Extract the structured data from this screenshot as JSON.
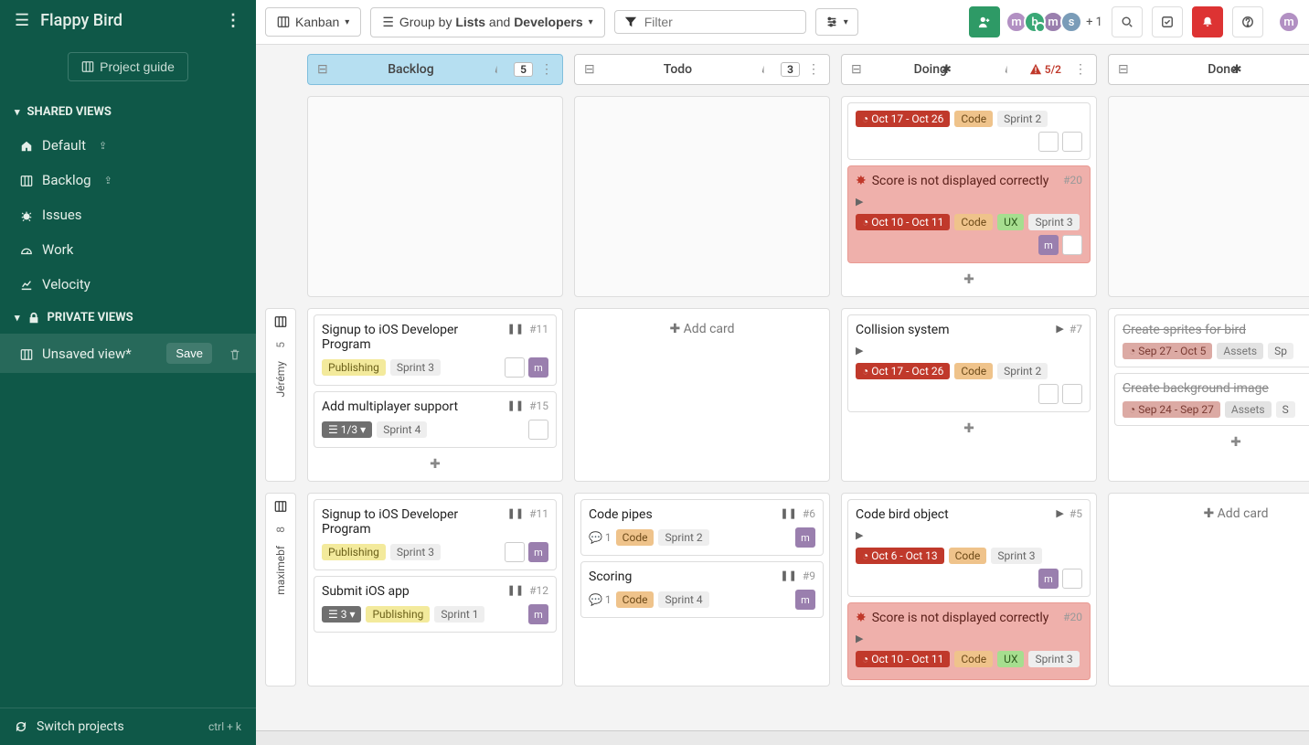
{
  "project": {
    "name": "Flappy Bird"
  },
  "sidebar": {
    "guide_label": "Project guide",
    "shared_label": "SHARED VIEWS",
    "private_label": "PRIVATE VIEWS",
    "shared": [
      {
        "label": "Default",
        "shared": true,
        "icon": "home"
      },
      {
        "label": "Backlog",
        "shared": true,
        "icon": "columns"
      },
      {
        "label": "Issues",
        "shared": false,
        "icon": "bug"
      },
      {
        "label": "Work",
        "shared": false,
        "icon": "gauge"
      },
      {
        "label": "Velocity",
        "shared": false,
        "icon": "chart"
      }
    ],
    "private": [
      {
        "label": "Unsaved view*",
        "save_label": "Save"
      }
    ],
    "switch_label": "Switch projects",
    "switch_kbd": "ctrl + k"
  },
  "toolbar": {
    "kanban_label": "Kanban",
    "group_prefix": "Group by ",
    "group_a": "Lists",
    "group_mid": " and ",
    "group_b": "Developers",
    "filter_placeholder": "Filter",
    "plus_count": "+ 1",
    "avatars": [
      "m",
      "b",
      "m",
      "s"
    ]
  },
  "columns": [
    {
      "id": "backlog",
      "title": "Backlog",
      "count": "5",
      "star": false,
      "alert": false
    },
    {
      "id": "todo",
      "title": "Todo",
      "count": "3",
      "star": false,
      "alert": false
    },
    {
      "id": "doing",
      "title": "Doing",
      "count": "5/2",
      "star": true,
      "alert": true
    },
    {
      "id": "done",
      "title": "Done",
      "count": "",
      "star": true,
      "alert": false
    }
  ],
  "add_card_label": "Add card",
  "swimlanes": [
    {
      "label": "",
      "count": "",
      "cells": {
        "backlog": {
          "cards": [],
          "show_add": false,
          "blank": true
        },
        "todo": {
          "cards": [],
          "show_add": false,
          "blank": true
        },
        "doing": {
          "cards": [
            {
              "partial_top": true,
              "date": "Oct 17 - Oct 26",
              "tags": [
                {
                  "t": "Code",
                  "k": "code"
                },
                {
                  "t": "Sprint 2",
                  "k": "sprint"
                }
              ],
              "avatars": [
                "blank",
                "blank"
              ]
            },
            {
              "bug": true,
              "red": true,
              "title": "Score is not displayed correctly",
              "num": "#20",
              "date": "Oct 10 - Oct 11",
              "tags": [
                {
                  "t": "Code",
                  "k": "code"
                },
                {
                  "t": "UX",
                  "k": "ux"
                },
                {
                  "t": "Sprint 3",
                  "k": "sprint"
                }
              ],
              "avatars": [
                "m",
                "blank"
              ]
            }
          ],
          "show_add": true
        },
        "done": {
          "cards": [],
          "show_add": false,
          "blank": true
        }
      }
    },
    {
      "label": "Jérémy",
      "count": "5",
      "cells": {
        "backlog": {
          "cards": [
            {
              "title": "Signup to iOS Developer Program",
              "num": "#11",
              "pause": true,
              "tags": [
                {
                  "t": "Publishing",
                  "k": "pub"
                },
                {
                  "t": "Sprint 3",
                  "k": "sprint"
                }
              ],
              "avatars": [
                "blank",
                "m"
              ]
            },
            {
              "title": "Add multiplayer support",
              "num": "#15",
              "pause": true,
              "chip": "1/3",
              "tags": [
                {
                  "t": "Sprint 4",
                  "k": "sprint"
                }
              ],
              "avatars": [
                "blank"
              ]
            }
          ],
          "show_add": true
        },
        "todo": {
          "cards": [],
          "add_center": true
        },
        "doing": {
          "cards": [
            {
              "title": "Collision system",
              "num": "#7",
              "play": true,
              "date": "Oct 17 - Oct 26",
              "tags": [
                {
                  "t": "Code",
                  "k": "code"
                },
                {
                  "t": "Sprint 2",
                  "k": "sprint"
                }
              ],
              "avatars": [
                "blank",
                "blank"
              ]
            }
          ],
          "show_add": true
        },
        "done": {
          "cards": [
            {
              "title": "Create sprites for bird",
              "done": true,
              "check": true,
              "date_muted": "Sep 27 - Oct 5",
              "tags": [
                {
                  "t": "Assets",
                  "k": "assets"
                },
                {
                  "t": "Sp",
                  "k": "sprint"
                }
              ]
            },
            {
              "title": "Create background image",
              "done": true,
              "check": true,
              "date_muted": "Sep 24 - Sep 27",
              "tags": [
                {
                  "t": "Assets",
                  "k": "assets"
                },
                {
                  "t": "S",
                  "k": "sprint"
                }
              ]
            }
          ],
          "show_add": true
        }
      }
    },
    {
      "label": "maximebf",
      "count": "8",
      "cells": {
        "backlog": {
          "cards": [
            {
              "title": "Signup to iOS Developer Program",
              "num": "#11",
              "pause": true,
              "tags": [
                {
                  "t": "Publishing",
                  "k": "pub"
                },
                {
                  "t": "Sprint 3",
                  "k": "sprint"
                }
              ],
              "avatars": [
                "blank",
                "m"
              ]
            },
            {
              "title": "Submit iOS app",
              "num": "#12",
              "pause": true,
              "chip": "3",
              "tags": [
                {
                  "t": "Publishing",
                  "k": "pub"
                },
                {
                  "t": "Sprint 1",
                  "k": "sprint"
                }
              ],
              "avatars": [
                "m"
              ]
            }
          ],
          "show_add": false
        },
        "todo": {
          "cards": [
            {
              "title": "Code pipes",
              "num": "#6",
              "pause": true,
              "comments": "1",
              "tags": [
                {
                  "t": "Code",
                  "k": "code"
                },
                {
                  "t": "Sprint 2",
                  "k": "sprint"
                }
              ],
              "avatars": [
                "m"
              ]
            },
            {
              "title": "Scoring",
              "num": "#9",
              "pause": true,
              "comments": "1",
              "tags": [
                {
                  "t": "Code",
                  "k": "code"
                },
                {
                  "t": "Sprint 4",
                  "k": "sprint"
                }
              ],
              "avatars": [
                "m"
              ]
            }
          ],
          "show_add": false
        },
        "doing": {
          "cards": [
            {
              "title": "Code bird object",
              "num": "#5",
              "play": true,
              "date": "Oct 6 - Oct 13",
              "tags": [
                {
                  "t": "Code",
                  "k": "code"
                },
                {
                  "t": "Sprint 3",
                  "k": "sprint"
                }
              ],
              "avatars": [
                "m",
                "blank"
              ]
            },
            {
              "bug": true,
              "red": true,
              "title": "Score is not displayed correctly",
              "num": "#20",
              "date": "Oct 10 - Oct 11",
              "tags": [
                {
                  "t": "Code",
                  "k": "code"
                },
                {
                  "t": "UX",
                  "k": "ux"
                },
                {
                  "t": "Sprint 3",
                  "k": "sprint"
                }
              ],
              "avatars": []
            }
          ],
          "show_add": false
        },
        "done": {
          "cards": [],
          "add_center": true
        }
      }
    }
  ]
}
